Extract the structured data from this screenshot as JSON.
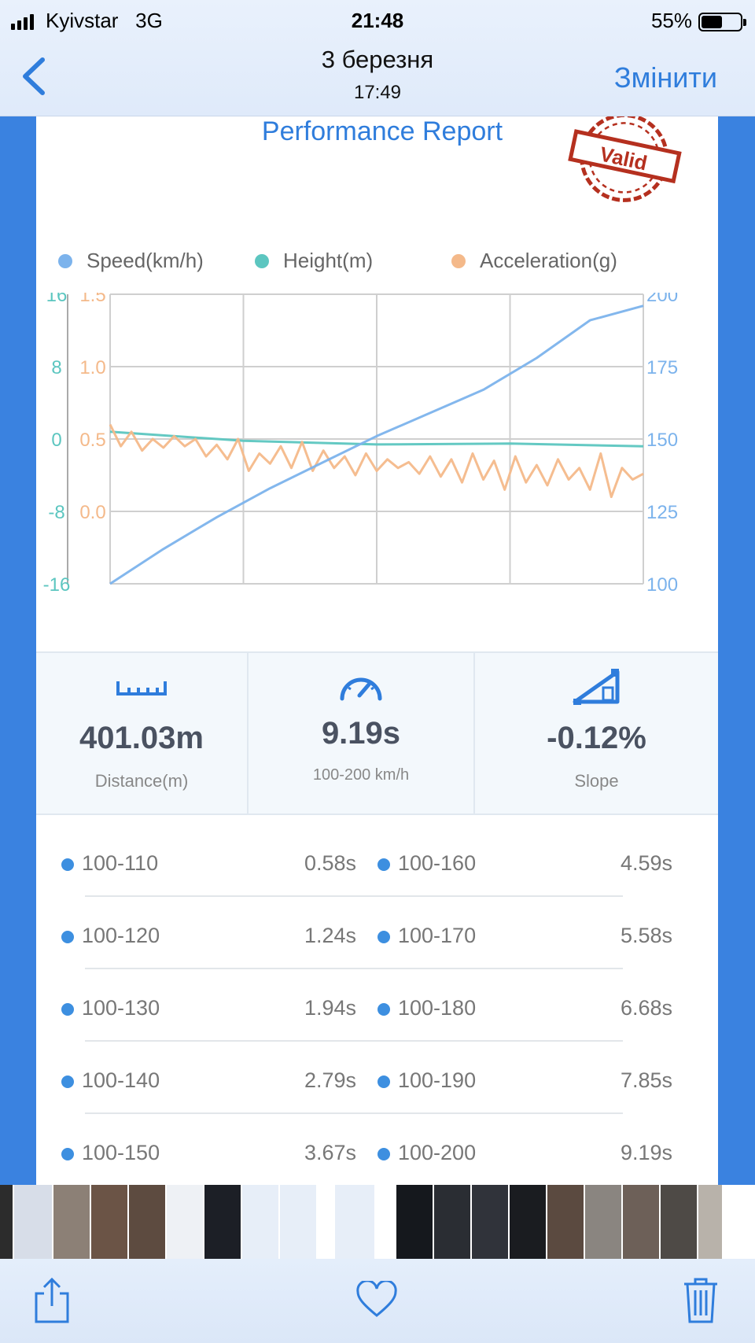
{
  "status": {
    "carrier": "Kyivstar",
    "network": "3G",
    "time": "21:48",
    "battery": "55%"
  },
  "nav": {
    "title": "3 березня",
    "subtitle": "17:49",
    "edit_label": "Змінити"
  },
  "report": {
    "title": "Performance Report",
    "stamp_text": "Valid"
  },
  "legend": [
    {
      "label": "Speed(km/h)",
      "color": "#7cb3ec"
    },
    {
      "label": "Height(m)",
      "color": "#5cc6c0"
    },
    {
      "label": "Acceleration(g)",
      "color": "#f4b98a"
    }
  ],
  "chart_data": {
    "type": "line",
    "x_axis": "time (unlabeled)",
    "axes": {
      "height_ticks": [
        "16",
        "8",
        "0",
        "-8",
        "-16"
      ],
      "acceleration_ticks": [
        "1.5",
        "1.0",
        "0.5",
        "0.0"
      ],
      "speed_ticks": [
        "200",
        "175",
        "150",
        "125",
        "100"
      ],
      "height_range": [
        -16,
        16
      ],
      "acceleration_range": [
        -0.5,
        1.5
      ],
      "speed_range": [
        100,
        200
      ]
    },
    "grid": true,
    "series": [
      {
        "name": "Speed(km/h)",
        "color": "#7cb3ec",
        "axis": "speed",
        "x": [
          0,
          0.1,
          0.2,
          0.3,
          0.4,
          0.5,
          0.6,
          0.7,
          0.8,
          0.9,
          1.0
        ],
        "values": [
          100,
          112,
          123,
          133,
          142,
          151,
          159,
          167,
          178,
          191,
          196
        ]
      },
      {
        "name": "Height(m)",
        "color": "#5cc6c0",
        "axis": "height",
        "x": [
          0,
          0.25,
          0.5,
          0.75,
          1.0
        ],
        "values": [
          0.8,
          -0.2,
          -0.6,
          -0.5,
          -0.8
        ]
      },
      {
        "name": "Acceleration(g)",
        "color": "#f4b98a",
        "axis": "acceleration",
        "x": [
          0,
          0.02,
          0.04,
          0.06,
          0.08,
          0.1,
          0.12,
          0.14,
          0.16,
          0.18,
          0.2,
          0.22,
          0.24,
          0.26,
          0.28,
          0.3,
          0.32,
          0.34,
          0.36,
          0.38,
          0.4,
          0.42,
          0.44,
          0.46,
          0.48,
          0.5,
          0.52,
          0.54,
          0.56,
          0.58,
          0.6,
          0.62,
          0.64,
          0.66,
          0.68,
          0.7,
          0.72,
          0.74,
          0.76,
          0.78,
          0.8,
          0.82,
          0.84,
          0.86,
          0.88,
          0.9,
          0.92,
          0.94,
          0.96,
          0.98,
          1.0
        ],
        "values": [
          0.6,
          0.45,
          0.55,
          0.42,
          0.5,
          0.44,
          0.52,
          0.45,
          0.5,
          0.38,
          0.46,
          0.36,
          0.5,
          0.28,
          0.4,
          0.33,
          0.45,
          0.3,
          0.48,
          0.28,
          0.42,
          0.3,
          0.38,
          0.25,
          0.4,
          0.28,
          0.36,
          0.3,
          0.34,
          0.26,
          0.38,
          0.24,
          0.36,
          0.2,
          0.4,
          0.22,
          0.35,
          0.15,
          0.38,
          0.2,
          0.32,
          0.18,
          0.36,
          0.22,
          0.3,
          0.15,
          0.4,
          0.1,
          0.3,
          0.22,
          0.26
        ]
      }
    ]
  },
  "stats": [
    {
      "icon": "ruler-icon",
      "value": "401.03m",
      "label": "Distance(m)"
    },
    {
      "icon": "speedometer-icon",
      "value": "9.19s",
      "label": "100-200 km/h"
    },
    {
      "icon": "slope-icon",
      "value": "-0.12%",
      "label": "Slope"
    }
  ],
  "splits": [
    {
      "left_range": "100-110",
      "left_time": "0.58s",
      "right_range": "100-160",
      "right_time": "4.59s"
    },
    {
      "left_range": "100-120",
      "left_time": "1.24s",
      "right_range": "100-170",
      "right_time": "5.58s"
    },
    {
      "left_range": "100-130",
      "left_time": "1.94s",
      "right_range": "100-180",
      "right_time": "6.68s"
    },
    {
      "left_range": "100-140",
      "left_time": "2.79s",
      "right_range": "100-190",
      "right_time": "7.85s"
    },
    {
      "left_range": "100-150",
      "left_time": "3.67s",
      "right_range": "100-200",
      "right_time": "9.19s"
    }
  ],
  "thumbnails": [
    {
      "color": "#2c2c2c",
      "w": 16
    },
    {
      "color": "#d7dde8",
      "w": 48
    },
    {
      "color": "#8c8076",
      "w": 46
    },
    {
      "color": "#6b5446",
      "w": 46
    },
    {
      "color": "#5d4b40",
      "w": 46
    },
    {
      "color": "#eef1f5",
      "w": 46
    },
    {
      "color": "#1c1f26",
      "w": 46
    },
    {
      "color": "#e7eef8",
      "w": 46
    },
    {
      "color": "#e7eef8",
      "w": 46
    },
    {
      "color": "#ffffff",
      "w": 20
    },
    {
      "color": "#e7eef8",
      "w": 50
    },
    {
      "color": "#ffffff",
      "w": 24
    },
    {
      "color": "#15181d",
      "w": 46
    },
    {
      "color": "#2a2d33",
      "w": 46
    },
    {
      "color": "#30333a",
      "w": 46
    },
    {
      "color": "#1a1c20",
      "w": 46
    },
    {
      "color": "#5b4a40",
      "w": 46
    },
    {
      "color": "#8a8580",
      "w": 46
    },
    {
      "color": "#6d6058",
      "w": 46
    },
    {
      "color": "#4e4a46",
      "w": 46
    },
    {
      "color": "#b8b2aa",
      "w": 30
    }
  ]
}
